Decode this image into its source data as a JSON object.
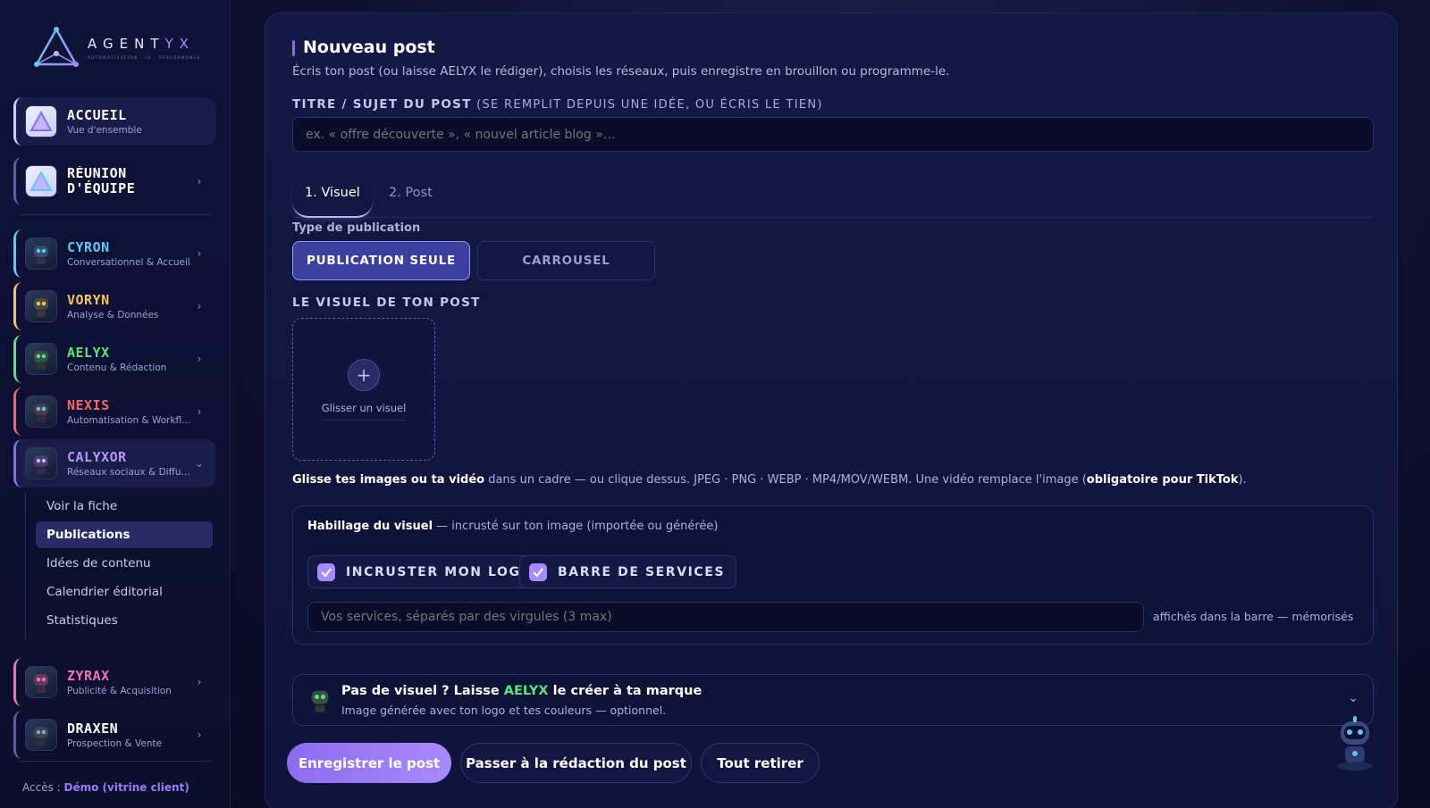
{
  "brand": {
    "name_main": "AGENT",
    "name_accent": "YX",
    "tagline": "AUTOMATISATION · IA · PERFORMANCE"
  },
  "sidebar": {
    "items": [
      {
        "title": "ACCUEIL",
        "subtitle": "Vue d'ensemble",
        "color": "#ffffff"
      },
      {
        "title_line1": "RÉUNION",
        "title_line2": "D'ÉQUIPE",
        "color": "#ffffff"
      },
      {
        "title": "CYRON",
        "subtitle": "Conversationnel & Accueil",
        "color": "#5ec8f5"
      },
      {
        "title": "VORYN",
        "subtitle": "Analyse & Données",
        "color": "#f5c25e"
      },
      {
        "title": "AELYX",
        "subtitle": "Contenu & Rédaction",
        "color": "#5ee07a"
      },
      {
        "title": "NEXIS",
        "subtitle": "Automatisation & Workfl...",
        "color": "#f56565"
      },
      {
        "title": "CALYXOR",
        "subtitle": "Réseaux sociaux & Diffusi...",
        "color": "#b794f6"
      },
      {
        "title": "ZYRAX",
        "subtitle": "Publicité & Acquisition",
        "color": "#f472b6"
      },
      {
        "title": "DRAXEN",
        "subtitle": "Prospection & Vente",
        "color": "#ffffff"
      }
    ],
    "submenu": [
      "Voir la fiche",
      "Publications",
      "Idées de contenu",
      "Calendrier éditorial",
      "Statistiques"
    ],
    "access_label": "Accès : ",
    "access_value": "Démo (vitrine client)"
  },
  "main": {
    "title": "Nouveau post",
    "subtitle": "Écris ton post (ou laisse AELYX le rédiger), choisis les réseaux, puis enregistre en brouillon ou programme-le.",
    "subject_label": "TITRE / SUJET DU POST",
    "subject_hint": " (SE REMPLIT DEPUIS UNE IDÉE, OU ÉCRIS LE TIEN)",
    "subject_placeholder": "ex. « offre découverte », « nouvel article blog »…",
    "tabs": [
      "1. Visuel",
      "2. Post"
    ],
    "type_label": "Type de publication",
    "types": [
      "PUBLICATION SEULE",
      "CARROUSEL"
    ],
    "visual_label": "LE VISUEL DE TON POST",
    "drop_text": "Glisser un visuel",
    "help_bold1": "Glisse tes images ou ta vidéo",
    "help_text": " dans un cadre — ou clique dessus. JPEG · PNG · WEBP · MP4/MOV/WEBM. Une vidéo remplace l'image (",
    "help_bold2": "obligatoire pour TikTok",
    "help_end": ").",
    "overlay": {
      "title": "Habillage du visuel",
      "hint": " — incrusté sur ton image (importée ou générée)",
      "check_logo": "INCRUSTER MON LOGO",
      "check_services": "BARRE DE SERVICES",
      "services_placeholder": "Vos services, séparés par des virgules (3 max)",
      "services_note": "affichés dans la barre — mémorisés"
    },
    "ai": {
      "title_start": "Pas de visuel ? Laisse ",
      "title_brand": "AELYX",
      "title_end": " le créer à ta marque",
      "subtitle": "Image générée avec ton logo et tes couleurs — optionnel."
    },
    "buttons": {
      "save": "Enregistrer le post",
      "next": "Passer à la rédaction du post",
      "clear": "Tout retirer"
    }
  },
  "colors": {
    "accent": "#8b6cf0",
    "aelyx": "#5ee07a"
  }
}
